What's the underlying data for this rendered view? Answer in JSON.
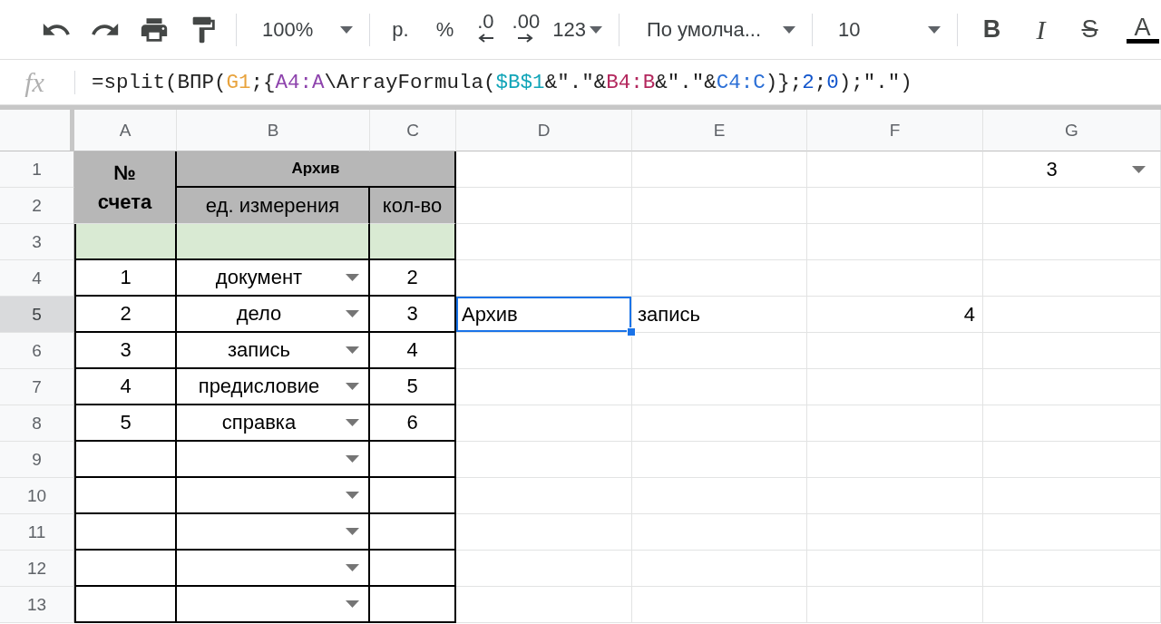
{
  "toolbar": {
    "zoom": "100%",
    "currency": "р.",
    "percent": "%",
    "decrease_decimals": ".0",
    "increase_decimals": ".00",
    "number_format": "123",
    "font": "По умолча...",
    "font_size": "10",
    "bold": "B",
    "italic": "I",
    "strikethrough": "S",
    "text_color": "A"
  },
  "formula_bar": {
    "label": "fx",
    "tokens": [
      {
        "text": "=split(ВПР(",
        "color": "#222222"
      },
      {
        "text": "G1",
        "color": "#e8a33d"
      },
      {
        "text": ";{",
        "color": "#222222"
      },
      {
        "text": "A4:A",
        "color": "#8e44ad"
      },
      {
        "text": "\\ArrayFormula(",
        "color": "#222222"
      },
      {
        "text": "$B$1",
        "color": "#12a5b8"
      },
      {
        "text": "&\".\"&",
        "color": "#222222"
      },
      {
        "text": "B4:B",
        "color": "#b3275d"
      },
      {
        "text": "&\".\"&",
        "color": "#222222"
      },
      {
        "text": "C4:C",
        "color": "#2b6fd6"
      },
      {
        "text": ")};",
        "color": "#222222"
      },
      {
        "text": "2",
        "color": "#1155cc"
      },
      {
        "text": ";",
        "color": "#222222"
      },
      {
        "text": "0",
        "color": "#1155cc"
      },
      {
        "text": ");\".\")",
        "color": "#222222"
      }
    ]
  },
  "sheet": {
    "columns": [
      {
        "label": "A",
        "selected": false
      },
      {
        "label": "B",
        "selected": false
      },
      {
        "label": "C",
        "selected": false
      },
      {
        "label": "D",
        "selected": false
      },
      {
        "label": "E",
        "selected": false
      },
      {
        "label": "F",
        "selected": false
      },
      {
        "label": "G",
        "selected": false
      }
    ],
    "header": {
      "number": "№ счета",
      "group": "Архив",
      "unit": "ед. измерения",
      "quantity": "кол-во"
    },
    "rows": [
      {
        "number": "1",
        "selected": false,
        "kind": "header",
        "cells": [
          {
            "dropdown": false,
            "selected": false
          },
          {
            "dropdown": false,
            "selected": false
          },
          {
            "dropdown": false,
            "selected": false
          },
          {
            "text": "3",
            "dropdown": true,
            "selected": false
          }
        ]
      },
      {
        "number": "2",
        "selected": false,
        "kind": "header",
        "cells": [
          {
            "dropdown": false,
            "selected": false
          },
          {
            "dropdown": false,
            "selected": false
          },
          {
            "dropdown": false,
            "selected": false
          },
          {
            "dropdown": false,
            "selected": false
          }
        ]
      },
      {
        "number": "3",
        "selected": false,
        "kind": "band",
        "cells": [
          {
            "dropdown": false,
            "selected": false
          },
          {
            "dropdown": false,
            "selected": false
          },
          {
            "dropdown": false,
            "selected": false
          },
          {
            "dropdown": false,
            "selected": false
          },
          {
            "dropdown": false,
            "selected": false
          },
          {
            "dropdown": false,
            "selected": false
          },
          {
            "dropdown": false,
            "selected": false
          }
        ]
      },
      {
        "number": "4",
        "selected": false,
        "kind": "data",
        "cells": [
          {
            "text": "1",
            "dropdown": false,
            "selected": false
          },
          {
            "text": "документ",
            "dropdown": true,
            "selected": false
          },
          {
            "text": "2",
            "dropdown": false,
            "selected": false
          },
          {
            "dropdown": false,
            "selected": false
          },
          {
            "dropdown": false,
            "selected": false
          },
          {
            "dropdown": false,
            "selected": false
          },
          {
            "dropdown": false,
            "selected": false
          }
        ]
      },
      {
        "number": "5",
        "selected": true,
        "kind": "data",
        "cells": [
          {
            "text": "2",
            "dropdown": false,
            "selected": false
          },
          {
            "text": "дело",
            "dropdown": true,
            "selected": false
          },
          {
            "text": "3",
            "dropdown": false,
            "selected": false
          },
          {
            "text": "Архив",
            "dropdown": false,
            "selected": true
          },
          {
            "text": "запись",
            "dropdown": false,
            "selected": false
          },
          {
            "text": "4",
            "dropdown": false,
            "selected": false
          },
          {
            "dropdown": false,
            "selected": false
          }
        ]
      },
      {
        "number": "6",
        "selected": false,
        "kind": "data",
        "cells": [
          {
            "text": "3",
            "dropdown": false,
            "selected": false
          },
          {
            "text": "запись",
            "dropdown": true,
            "selected": false
          },
          {
            "text": "4",
            "dropdown": false,
            "selected": false
          },
          {
            "dropdown": false,
            "selected": false
          },
          {
            "dropdown": false,
            "selected": false
          },
          {
            "dropdown": false,
            "selected": false
          },
          {
            "dropdown": false,
            "selected": false
          }
        ]
      },
      {
        "number": "7",
        "selected": false,
        "kind": "data",
        "cells": [
          {
            "text": "4",
            "dropdown": false,
            "selected": false
          },
          {
            "text": "предисловие",
            "dropdown": true,
            "selected": false
          },
          {
            "text": "5",
            "dropdown": false,
            "selected": false
          },
          {
            "dropdown": false,
            "selected": false
          },
          {
            "dropdown": false,
            "selected": false
          },
          {
            "dropdown": false,
            "selected": false
          },
          {
            "dropdown": false,
            "selected": false
          }
        ]
      },
      {
        "number": "8",
        "selected": false,
        "kind": "data",
        "cells": [
          {
            "text": "5",
            "dropdown": false,
            "selected": false
          },
          {
            "text": "справка",
            "dropdown": true,
            "selected": false
          },
          {
            "text": "6",
            "dropdown": false,
            "selected": false
          },
          {
            "dropdown": false,
            "selected": false
          },
          {
            "dropdown": false,
            "selected": false
          },
          {
            "dropdown": false,
            "selected": false
          },
          {
            "dropdown": false,
            "selected": false
          }
        ]
      },
      {
        "number": "9",
        "selected": false,
        "kind": "data",
        "cells": [
          {
            "dropdown": false,
            "selected": false
          },
          {
            "dropdown": true,
            "selected": false
          },
          {
            "dropdown": false,
            "selected": false
          },
          {
            "dropdown": false,
            "selected": false
          },
          {
            "dropdown": false,
            "selected": false
          },
          {
            "dropdown": false,
            "selected": false
          },
          {
            "dropdown": false,
            "selected": false
          }
        ]
      },
      {
        "number": "10",
        "selected": false,
        "kind": "data",
        "cells": [
          {
            "dropdown": false,
            "selected": false
          },
          {
            "dropdown": true,
            "selected": false
          },
          {
            "dropdown": false,
            "selected": false
          },
          {
            "dropdown": false,
            "selected": false
          },
          {
            "dropdown": false,
            "selected": false
          },
          {
            "dropdown": false,
            "selected": false
          },
          {
            "dropdown": false,
            "selected": false
          }
        ]
      },
      {
        "number": "11",
        "selected": false,
        "kind": "data",
        "cells": [
          {
            "dropdown": false,
            "selected": false
          },
          {
            "dropdown": true,
            "selected": false
          },
          {
            "dropdown": false,
            "selected": false
          },
          {
            "dropdown": false,
            "selected": false
          },
          {
            "dropdown": false,
            "selected": false
          },
          {
            "dropdown": false,
            "selected": false
          },
          {
            "dropdown": false,
            "selected": false
          }
        ]
      },
      {
        "number": "12",
        "selected": false,
        "kind": "data",
        "cells": [
          {
            "dropdown": false,
            "selected": false
          },
          {
            "dropdown": true,
            "selected": false
          },
          {
            "dropdown": false,
            "selected": false
          },
          {
            "dropdown": false,
            "selected": false
          },
          {
            "dropdown": false,
            "selected": false
          },
          {
            "dropdown": false,
            "selected": false
          },
          {
            "dropdown": false,
            "selected": false
          }
        ]
      },
      {
        "number": "13",
        "selected": false,
        "kind": "data",
        "cells": [
          {
            "dropdown": false,
            "selected": false
          },
          {
            "dropdown": true,
            "selected": false
          },
          {
            "dropdown": false,
            "selected": false
          },
          {
            "dropdown": false,
            "selected": false
          },
          {
            "dropdown": false,
            "selected": false
          },
          {
            "dropdown": false,
            "selected": false
          },
          {
            "dropdown": false,
            "selected": false
          }
        ]
      }
    ]
  }
}
